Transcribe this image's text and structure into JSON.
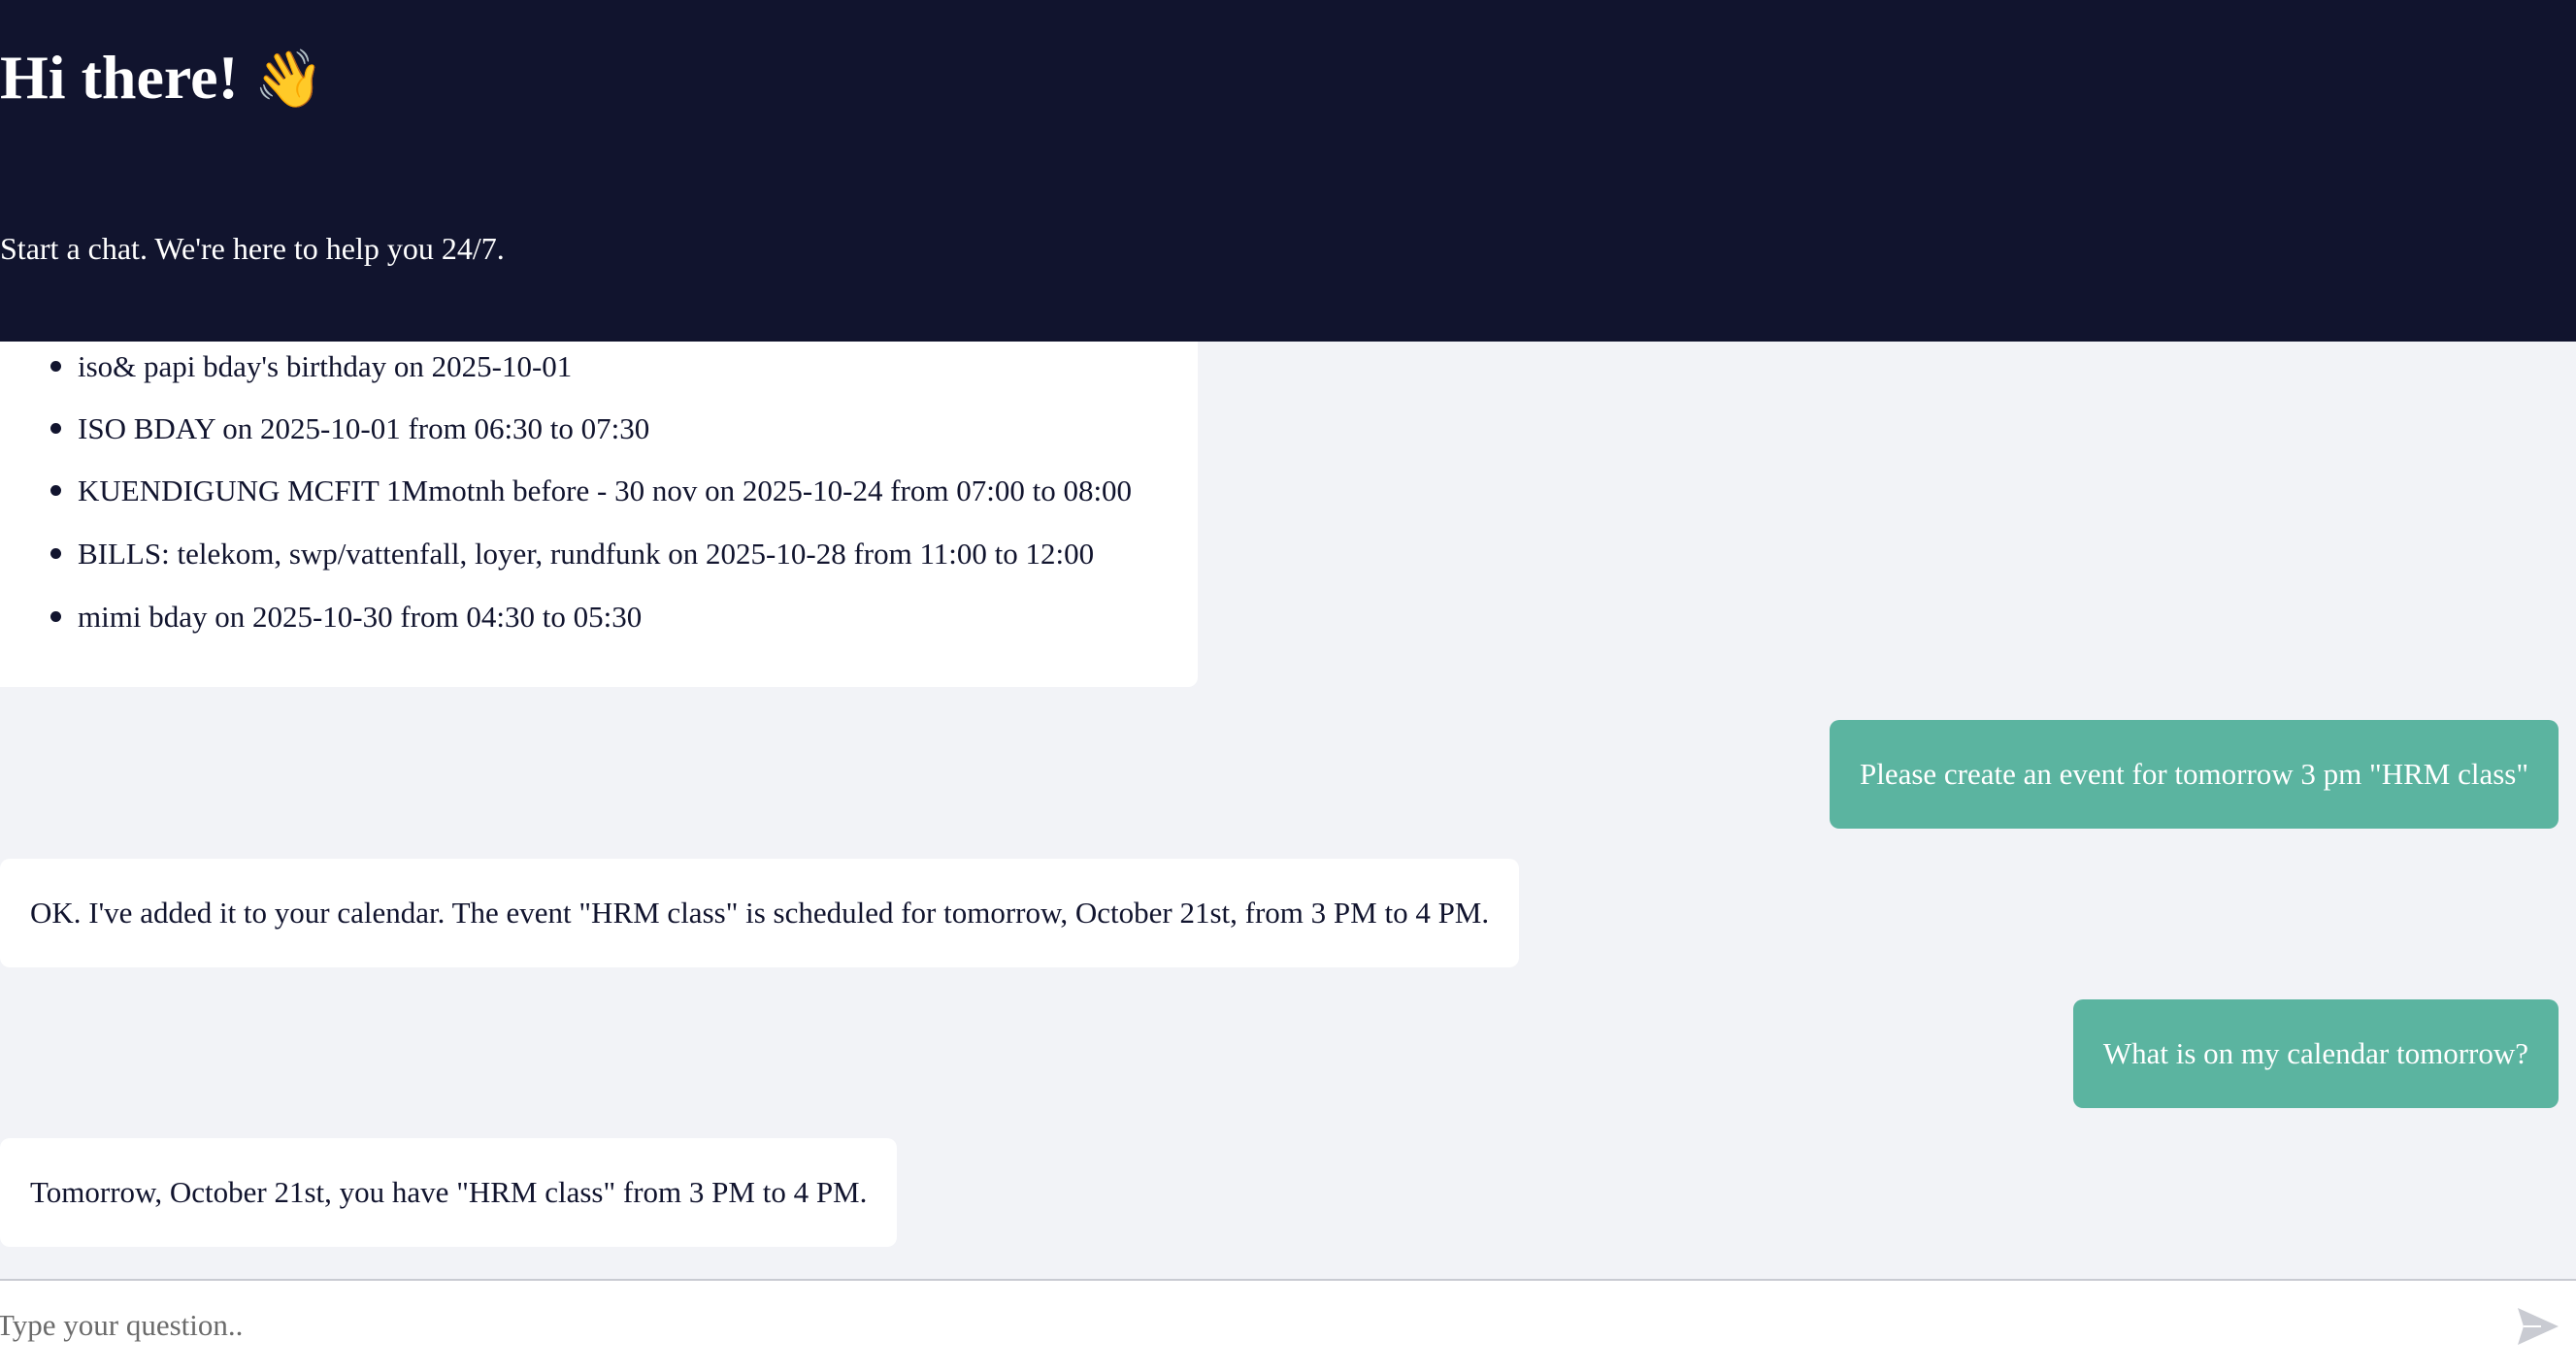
{
  "header": {
    "title": "Hi there!",
    "title_emoji": "👋",
    "subtitle": "Start a chat. We're here to help you 24/7."
  },
  "messages": [
    {
      "role": "bot",
      "items": [
        "iso& papi bday's birthday on 2025-10-01",
        "ISO BDAY on 2025-10-01 from 06:30 to 07:30",
        "KUENDIGUNG MCFIT 1Mmotnh before - 30 nov on 2025-10-24 from 07:00 to 08:00",
        "BILLS: telekom, swp/vattenfall, loyer, rundfunk on 2025-10-28 from 11:00 to 12:00",
        "mimi bday on 2025-10-30 from 04:30 to 05:30"
      ]
    },
    {
      "role": "user",
      "text": "Please create an event for tomorrow 3 pm \"HRM class\""
    },
    {
      "role": "bot",
      "text": "OK. I've added it to your calendar. The event \"HRM class\" is scheduled for tomorrow, October 21st, from 3 PM to 4 PM."
    },
    {
      "role": "user",
      "text": "What is on my calendar tomorrow?"
    },
    {
      "role": "bot",
      "text": "Tomorrow, October 21st, you have \"HRM class\" from 3 PM to 4 PM."
    }
  ],
  "input": {
    "placeholder": "Type your question..",
    "value": ""
  },
  "icons": {
    "send": "send-icon",
    "wave": "waving-hand-icon"
  },
  "colors": {
    "header_bg": "#11142e",
    "user_bubble": "#5bb4a0",
    "chat_bg": "#f2f3f7",
    "bot_bubble": "#ffffff"
  }
}
